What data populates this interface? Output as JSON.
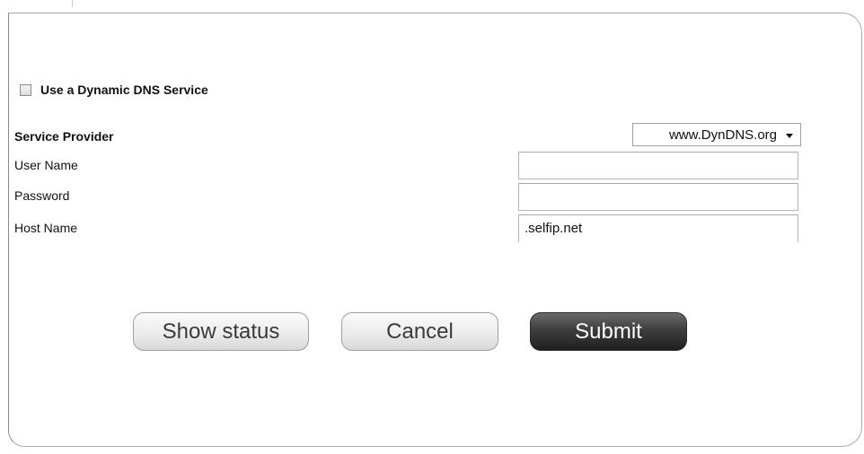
{
  "ddns": {
    "checkbox_label": "Use a Dynamic DNS Service",
    "checked": false
  },
  "form": {
    "service_provider": {
      "label": "Service Provider",
      "selected": "www.DynDNS.org"
    },
    "user_name": {
      "label": "User Name",
      "value": ""
    },
    "password": {
      "label": "Password",
      "value": ""
    },
    "host_name": {
      "label": "Host Name",
      "value": ".selfip.net"
    }
  },
  "buttons": {
    "show_status": "Show status",
    "cancel": "Cancel",
    "submit": "Submit"
  },
  "colors": {
    "submit_bg": "#3e3e3e",
    "secondary_bg": "#ececec",
    "border": "#a9a9a9"
  }
}
